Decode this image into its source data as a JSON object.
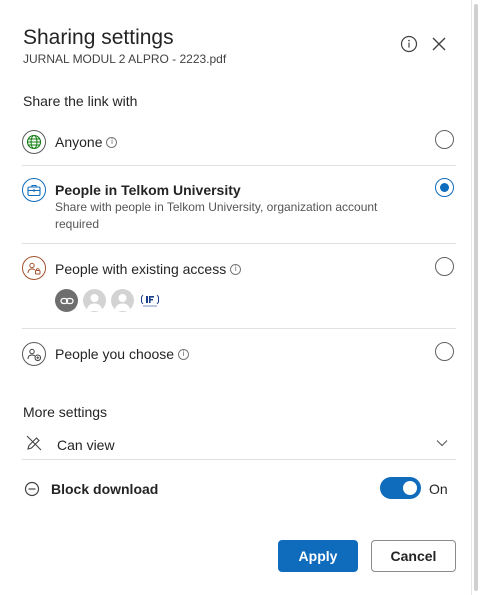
{
  "header": {
    "title": "Sharing settings",
    "file_name": "JURNAL MODUL 2 ALPRO - 2223.pdf"
  },
  "share_section": {
    "label": "Share the link with",
    "options": [
      {
        "label": "Anyone",
        "icon": "globe-icon",
        "has_info": true,
        "selected": false
      },
      {
        "label": "People in Telkom University",
        "icon": "briefcase-icon",
        "description": "Share with people in Telkom University, organization account required",
        "has_info": false,
        "selected": true
      },
      {
        "label": "People with existing access",
        "icon": "people-lock-icon",
        "has_info": true,
        "selected": false
      },
      {
        "label": "People you choose",
        "icon": "people-add-icon",
        "has_info": true,
        "selected": false
      }
    ],
    "existing_access_avatars": [
      "link-avatar",
      "person-avatar",
      "person-avatar",
      "logo-avatar"
    ]
  },
  "more_settings": {
    "label": "More settings",
    "permission": {
      "label": "Can view",
      "icon": "pencil-off-icon"
    },
    "block_download": {
      "label": "Block download",
      "state_label": "On",
      "enabled": true
    }
  },
  "actions": {
    "apply_label": "Apply",
    "cancel_label": "Cancel"
  },
  "colors": {
    "accent": "#0f6cbd",
    "text": "#242424",
    "divider": "#e1e1e1"
  }
}
